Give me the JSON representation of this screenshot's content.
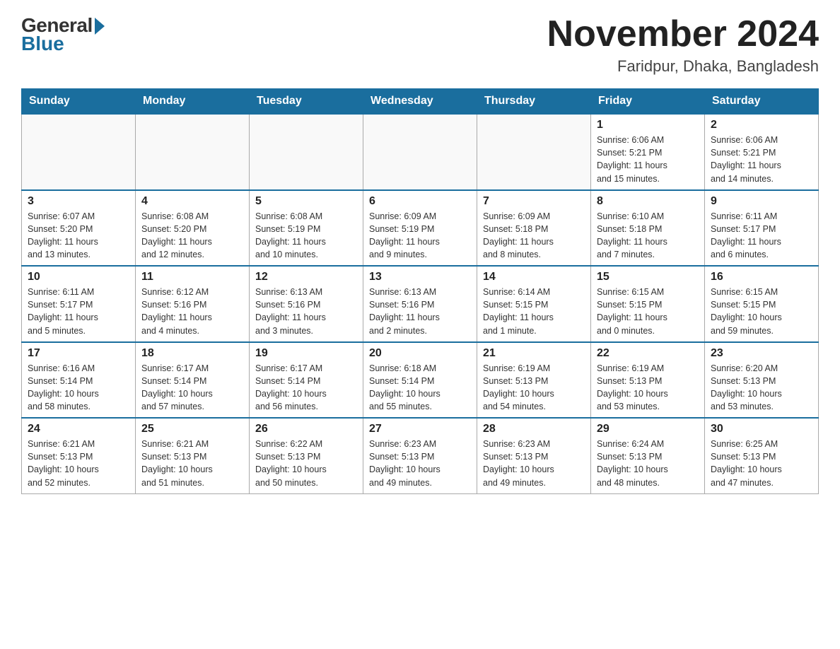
{
  "header": {
    "logo": {
      "general": "General",
      "blue": "Blue"
    },
    "title": "November 2024",
    "location": "Faridpur, Dhaka, Bangladesh"
  },
  "weekdays": [
    "Sunday",
    "Monday",
    "Tuesday",
    "Wednesday",
    "Thursday",
    "Friday",
    "Saturday"
  ],
  "weeks": [
    [
      {
        "day": "",
        "info": ""
      },
      {
        "day": "",
        "info": ""
      },
      {
        "day": "",
        "info": ""
      },
      {
        "day": "",
        "info": ""
      },
      {
        "day": "",
        "info": ""
      },
      {
        "day": "1",
        "info": "Sunrise: 6:06 AM\nSunset: 5:21 PM\nDaylight: 11 hours\nand 15 minutes."
      },
      {
        "day": "2",
        "info": "Sunrise: 6:06 AM\nSunset: 5:21 PM\nDaylight: 11 hours\nand 14 minutes."
      }
    ],
    [
      {
        "day": "3",
        "info": "Sunrise: 6:07 AM\nSunset: 5:20 PM\nDaylight: 11 hours\nand 13 minutes."
      },
      {
        "day": "4",
        "info": "Sunrise: 6:08 AM\nSunset: 5:20 PM\nDaylight: 11 hours\nand 12 minutes."
      },
      {
        "day": "5",
        "info": "Sunrise: 6:08 AM\nSunset: 5:19 PM\nDaylight: 11 hours\nand 10 minutes."
      },
      {
        "day": "6",
        "info": "Sunrise: 6:09 AM\nSunset: 5:19 PM\nDaylight: 11 hours\nand 9 minutes."
      },
      {
        "day": "7",
        "info": "Sunrise: 6:09 AM\nSunset: 5:18 PM\nDaylight: 11 hours\nand 8 minutes."
      },
      {
        "day": "8",
        "info": "Sunrise: 6:10 AM\nSunset: 5:18 PM\nDaylight: 11 hours\nand 7 minutes."
      },
      {
        "day": "9",
        "info": "Sunrise: 6:11 AM\nSunset: 5:17 PM\nDaylight: 11 hours\nand 6 minutes."
      }
    ],
    [
      {
        "day": "10",
        "info": "Sunrise: 6:11 AM\nSunset: 5:17 PM\nDaylight: 11 hours\nand 5 minutes."
      },
      {
        "day": "11",
        "info": "Sunrise: 6:12 AM\nSunset: 5:16 PM\nDaylight: 11 hours\nand 4 minutes."
      },
      {
        "day": "12",
        "info": "Sunrise: 6:13 AM\nSunset: 5:16 PM\nDaylight: 11 hours\nand 3 minutes."
      },
      {
        "day": "13",
        "info": "Sunrise: 6:13 AM\nSunset: 5:16 PM\nDaylight: 11 hours\nand 2 minutes."
      },
      {
        "day": "14",
        "info": "Sunrise: 6:14 AM\nSunset: 5:15 PM\nDaylight: 11 hours\nand 1 minute."
      },
      {
        "day": "15",
        "info": "Sunrise: 6:15 AM\nSunset: 5:15 PM\nDaylight: 11 hours\nand 0 minutes."
      },
      {
        "day": "16",
        "info": "Sunrise: 6:15 AM\nSunset: 5:15 PM\nDaylight: 10 hours\nand 59 minutes."
      }
    ],
    [
      {
        "day": "17",
        "info": "Sunrise: 6:16 AM\nSunset: 5:14 PM\nDaylight: 10 hours\nand 58 minutes."
      },
      {
        "day": "18",
        "info": "Sunrise: 6:17 AM\nSunset: 5:14 PM\nDaylight: 10 hours\nand 57 minutes."
      },
      {
        "day": "19",
        "info": "Sunrise: 6:17 AM\nSunset: 5:14 PM\nDaylight: 10 hours\nand 56 minutes."
      },
      {
        "day": "20",
        "info": "Sunrise: 6:18 AM\nSunset: 5:14 PM\nDaylight: 10 hours\nand 55 minutes."
      },
      {
        "day": "21",
        "info": "Sunrise: 6:19 AM\nSunset: 5:13 PM\nDaylight: 10 hours\nand 54 minutes."
      },
      {
        "day": "22",
        "info": "Sunrise: 6:19 AM\nSunset: 5:13 PM\nDaylight: 10 hours\nand 53 minutes."
      },
      {
        "day": "23",
        "info": "Sunrise: 6:20 AM\nSunset: 5:13 PM\nDaylight: 10 hours\nand 53 minutes."
      }
    ],
    [
      {
        "day": "24",
        "info": "Sunrise: 6:21 AM\nSunset: 5:13 PM\nDaylight: 10 hours\nand 52 minutes."
      },
      {
        "day": "25",
        "info": "Sunrise: 6:21 AM\nSunset: 5:13 PM\nDaylight: 10 hours\nand 51 minutes."
      },
      {
        "day": "26",
        "info": "Sunrise: 6:22 AM\nSunset: 5:13 PM\nDaylight: 10 hours\nand 50 minutes."
      },
      {
        "day": "27",
        "info": "Sunrise: 6:23 AM\nSunset: 5:13 PM\nDaylight: 10 hours\nand 49 minutes."
      },
      {
        "day": "28",
        "info": "Sunrise: 6:23 AM\nSunset: 5:13 PM\nDaylight: 10 hours\nand 49 minutes."
      },
      {
        "day": "29",
        "info": "Sunrise: 6:24 AM\nSunset: 5:13 PM\nDaylight: 10 hours\nand 48 minutes."
      },
      {
        "day": "30",
        "info": "Sunrise: 6:25 AM\nSunset: 5:13 PM\nDaylight: 10 hours\nand 47 minutes."
      }
    ]
  ]
}
